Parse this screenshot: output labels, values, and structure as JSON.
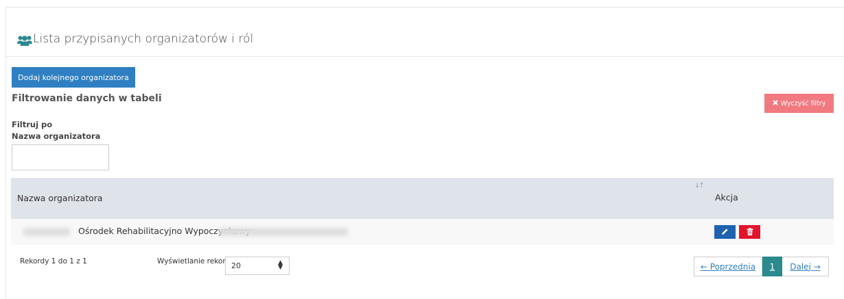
{
  "header": {
    "title": "Lista przypisanych organizatorów i ról",
    "icon": "users-icon"
  },
  "toolbar": {
    "add_label": "Dodaj kolejnego organizatora",
    "add_color": "#2f7fc2"
  },
  "filters": {
    "heading": "Filtrowanie danych w tabeli",
    "clear_label": "Wyczyść filtry",
    "clear_color": "#f07a80",
    "filter_by": "Filtruj po",
    "field_label": "Nazwa organizatora",
    "field_value": ""
  },
  "table": {
    "columns": [
      "Nazwa organizatora",
      "Akcja"
    ],
    "rows": [
      {
        "name": "Ośrodek Rehabilitacyjno Wypoczynkowy"
      }
    ],
    "edit_color": "#1f63b0",
    "delete_color": "#e0152b"
  },
  "footer": {
    "records_info": "Rekordy 1 do 1 z 1",
    "per_page_label": "Wyświetlanie rekordów",
    "per_page_value": "20",
    "prev_label": "← Poprzednia",
    "current_page": "1",
    "next_label": "Dalej →",
    "active_page_color": "#2a8a8e"
  }
}
